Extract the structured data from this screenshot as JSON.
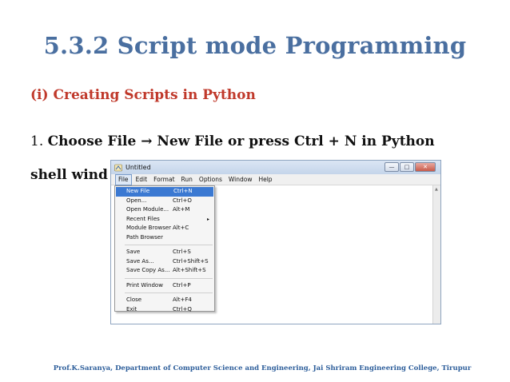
{
  "slide": {
    "title": "5.3.2 Script mode Programming",
    "subhead": "(i) Creating Scripts in Python",
    "step_number": "1.",
    "step_text_1": "Choose File → New File or press Ctrl + N in Python",
    "step_text_2": "shell wind",
    "footer": "Prof.K.Saranya, Department of Computer Science and Engineering, Jai Shriram Engineering College, Tirupur"
  },
  "window": {
    "title": "Untitled",
    "buttons": {
      "minimize": "—",
      "maximize": "□",
      "close": "✕"
    },
    "menubar": [
      {
        "label": "File"
      },
      {
        "label": "Edit"
      },
      {
        "label": "Format"
      },
      {
        "label": "Run"
      },
      {
        "label": "Options"
      },
      {
        "label": "Window"
      },
      {
        "label": "Help"
      }
    ]
  },
  "file_menu": {
    "items": [
      {
        "label": "New File",
        "shortcut": "Ctrl+N"
      },
      {
        "label": "Open...",
        "shortcut": "Ctrl+O"
      },
      {
        "label": "Open Module...",
        "shortcut": "Alt+M"
      },
      {
        "label": "Recent Files",
        "shortcut": ""
      },
      {
        "label": "Module Browser",
        "shortcut": "Alt+C"
      },
      {
        "label": "Path Browser",
        "shortcut": ""
      },
      {
        "label": "Save",
        "shortcut": "Ctrl+S"
      },
      {
        "label": "Save As...",
        "shortcut": "Ctrl+Shift+S"
      },
      {
        "label": "Save Copy As...",
        "shortcut": "Alt+Shift+S"
      },
      {
        "label": "Print Window",
        "shortcut": "Ctrl+P"
      },
      {
        "label": "Close",
        "shortcut": "Alt+F4"
      },
      {
        "label": "Exit",
        "shortcut": "Ctrl+Q"
      }
    ],
    "submenu_arrow": "▸"
  },
  "icons": {
    "app": "python-idle-icon",
    "scroll_up": "scroll-up-arrow-icon"
  },
  "colors": {
    "title": "#4a6fa0",
    "subhead": "#c0392b",
    "highlight": "#3b79d2",
    "footer": "#2c5d9a"
  }
}
